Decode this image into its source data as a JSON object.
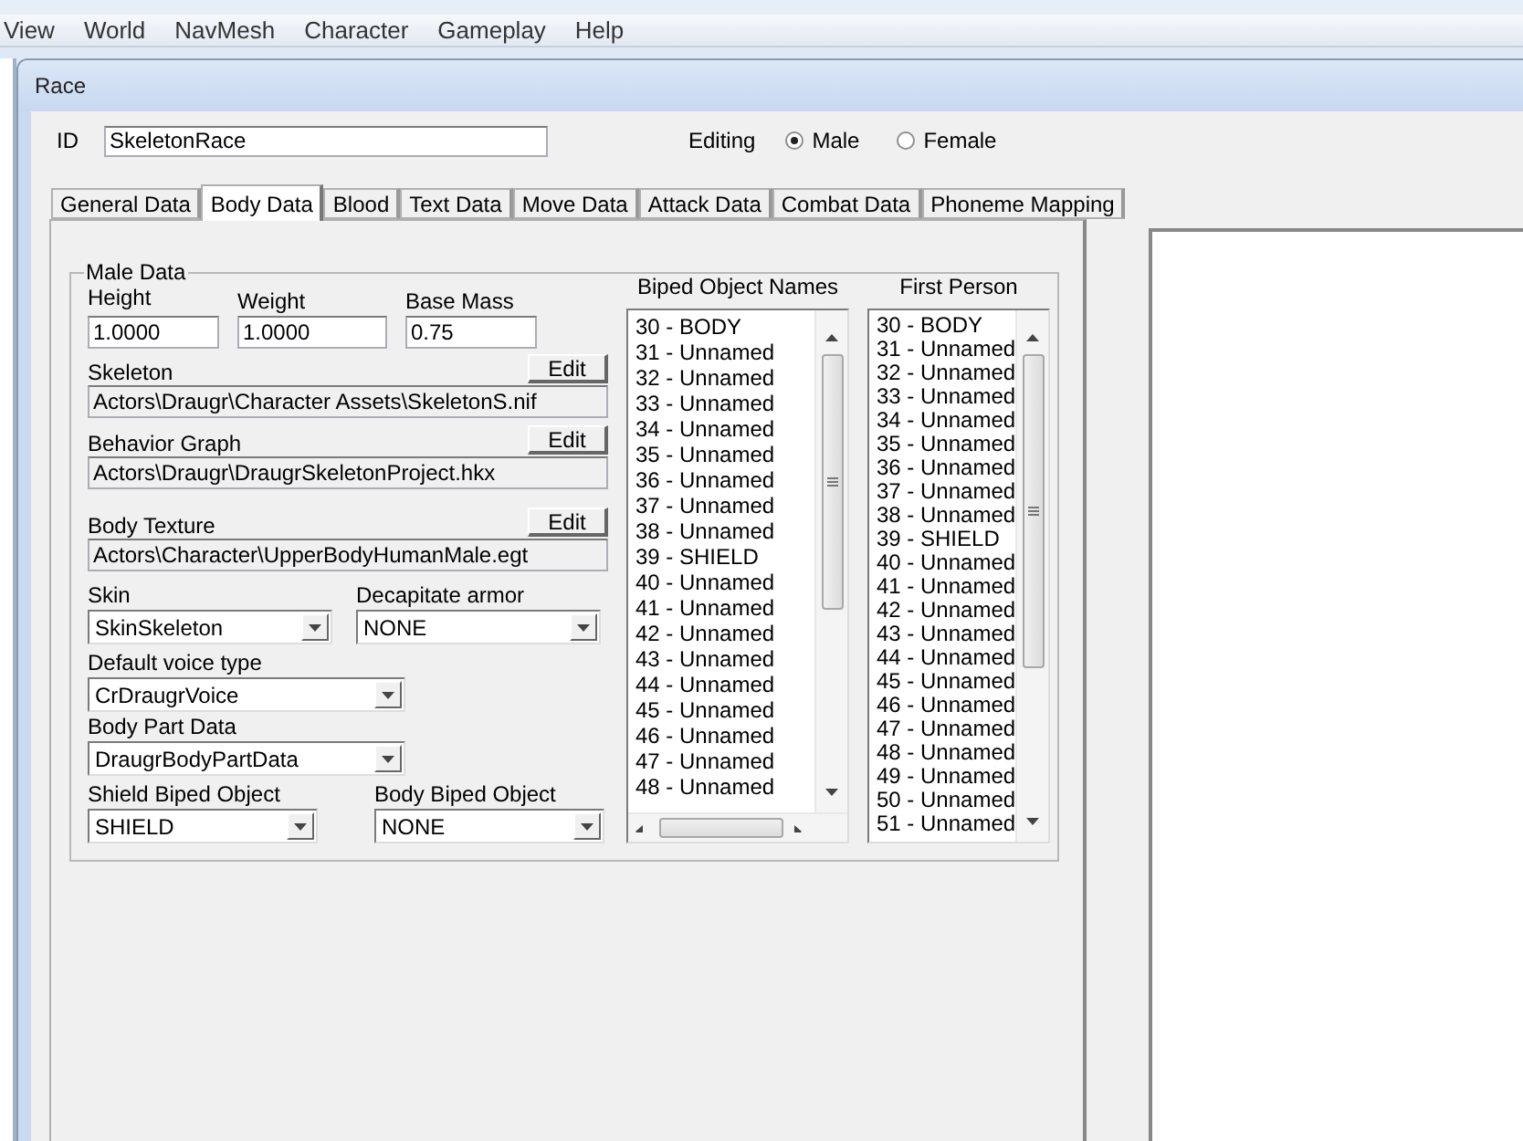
{
  "menu": [
    "View",
    "World",
    "NavMesh",
    "Character",
    "Gameplay",
    "Help"
  ],
  "dialog": {
    "title": "Race"
  },
  "id_field": {
    "label": "ID",
    "value": "SkeletonRace"
  },
  "editing": {
    "label": "Editing",
    "options": [
      {
        "label": "Male",
        "selected": true
      },
      {
        "label": "Female",
        "selected": false
      }
    ]
  },
  "tabs": [
    {
      "label": "General Data",
      "selected": false
    },
    {
      "label": "Body Data",
      "selected": true
    },
    {
      "label": "Blood",
      "selected": false
    },
    {
      "label": "Text Data",
      "selected": false
    },
    {
      "label": "Move Data",
      "selected": false
    },
    {
      "label": "Attack Data",
      "selected": false
    },
    {
      "label": "Combat Data",
      "selected": false
    },
    {
      "label": "Phoneme Mapping",
      "selected": false
    }
  ],
  "male_data": {
    "title": "Male Data",
    "numbers": [
      {
        "label": "Height",
        "value": "1.0000"
      },
      {
        "label": "Weight",
        "value": "1.0000"
      },
      {
        "label": "Base Mass",
        "value": "0.75"
      }
    ],
    "paths": [
      {
        "label": "Skeleton",
        "value": "Actors\\Draugr\\Character Assets\\SkeletonS.nif",
        "button": "Edit"
      },
      {
        "label": "Behavior Graph",
        "value": "Actors\\Draugr\\DraugrSkeletonProject.hkx",
        "button": "Edit"
      },
      {
        "label": "Body Texture",
        "value": "Actors\\Character\\UpperBodyHumanMale.egt",
        "button": "Edit"
      }
    ],
    "dropdown_rows": [
      [
        {
          "label": "Skin",
          "value": "SkinSkeleton"
        },
        {
          "label": "Decapitate armor",
          "value": "NONE"
        }
      ],
      [
        {
          "label": "Default voice type",
          "value": "CrDraugrVoice"
        }
      ],
      [
        {
          "label": "Body Part Data",
          "value": "DraugrBodyPartData"
        }
      ],
      [
        {
          "label": "Shield Biped Object",
          "value": "SHIELD"
        },
        {
          "label": "Body Biped Object",
          "value": "NONE"
        }
      ]
    ],
    "biped_lists": [
      {
        "title": "Biped Object Names",
        "horizontal_scroll": true,
        "items": [
          "30 - BODY",
          "31 - Unnamed",
          "32 - Unnamed",
          "33 - Unnamed",
          "34 - Unnamed",
          "35 - Unnamed",
          "36 - Unnamed",
          "37 - Unnamed",
          "38 - Unnamed",
          "39 - SHIELD",
          "40 - Unnamed",
          "41 - Unnamed",
          "42 - Unnamed",
          "43 - Unnamed",
          "44 - Unnamed",
          "45 - Unnamed",
          "46 - Unnamed",
          "47 - Unnamed",
          "48 - Unnamed"
        ]
      },
      {
        "title": "First Person",
        "horizontal_scroll": false,
        "items": [
          "30 - BODY",
          "31 - Unnamed",
          "32 - Unnamed",
          "33 - Unnamed",
          "34 - Unnamed",
          "35 - Unnamed",
          "36 - Unnamed",
          "37 - Unnamed",
          "38 - Unnamed",
          "39 - SHIELD",
          "40 - Unnamed",
          "41 - Unnamed",
          "42 - Unnamed",
          "43 - Unnamed",
          "44 - Unnamed",
          "45 - Unnamed",
          "46 - Unnamed",
          "47 - Unnamed",
          "48 - Unnamed",
          "49 - Unnamed",
          "50 - Unnamed",
          "51 - Unnamed"
        ]
      }
    ]
  }
}
